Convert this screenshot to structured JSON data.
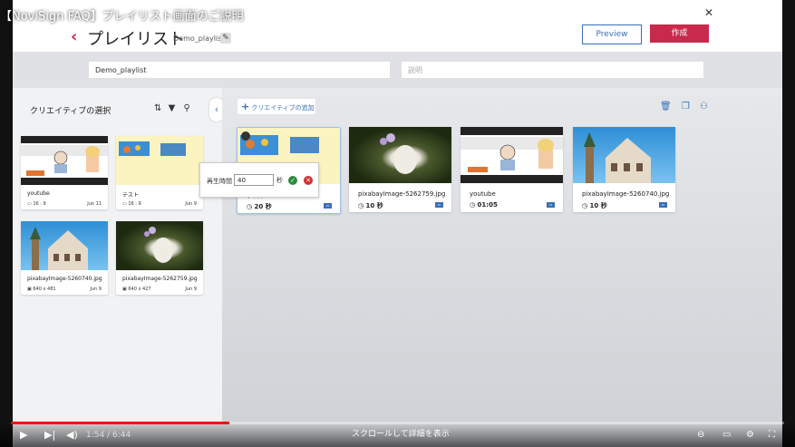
{
  "video_title": "【NoviSign FAQ】プレイリスト画面のご説明",
  "watermark": "novisign",
  "app": {
    "back_symbol": "‹",
    "page_title": "プレイリスト",
    "playlist_name_sub": "Demo_playlist *",
    "preview_label": "Preview",
    "create_label": "作成",
    "name_input_value": "Demo_playlist",
    "desc_placeholder": "説明"
  },
  "left_panel": {
    "title": "クリエイティブの選択",
    "items": [
      {
        "name": "youtube",
        "meta": "16 : 9",
        "date": "Jun 11"
      },
      {
        "name": "テスト",
        "meta": "16 : 9",
        "date": "Jun 9"
      },
      {
        "name": "pixabayImage-5260740.jpg",
        "meta": "640 x 481",
        "date": "Jun 9"
      },
      {
        "name": "pixabayImage-5262759.jpg",
        "meta": "640 x 427",
        "date": "Jun 9"
      }
    ]
  },
  "main": {
    "add_label": "クリエイティブの追加",
    "items": [
      {
        "name": "テスト",
        "duration": "20 秒"
      },
      {
        "name": "pixabayImage-5262759.jpg",
        "duration": "10 秒"
      },
      {
        "name": "youtube",
        "duration": "01:05"
      },
      {
        "name": "pixabayImage-5260740.jpg",
        "duration": "10 秒"
      }
    ],
    "popup": {
      "label": "再生時間",
      "value": "40",
      "unit": "秒"
    }
  },
  "player": {
    "time": "1:54 / 6:44",
    "progress": 0.282,
    "scroll_hint": "スクロールして詳細を表示"
  },
  "colors": {
    "accent": "#c8294c",
    "blue": "#3a6fb5",
    "progress": "#ff0000"
  }
}
